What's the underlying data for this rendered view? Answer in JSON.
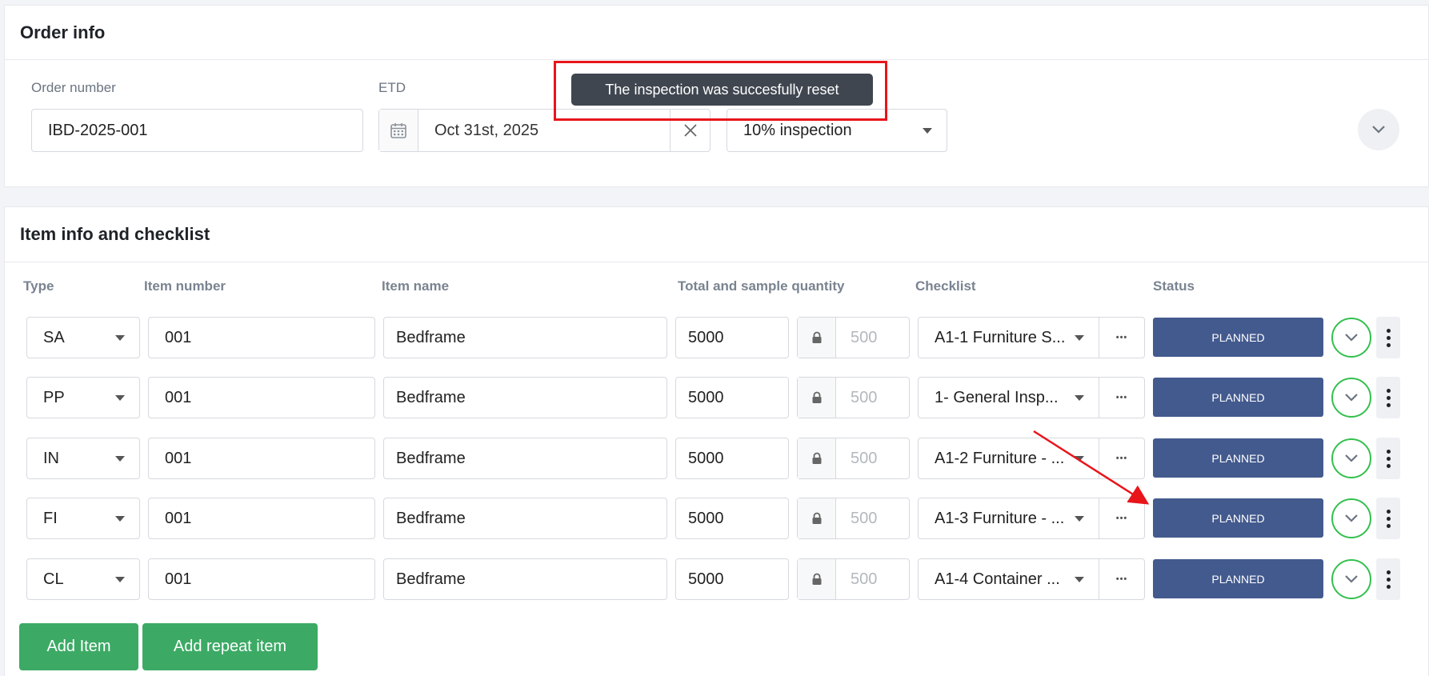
{
  "order_info": {
    "title": "Order info",
    "order_number_label": "Order number",
    "order_number_value": "IBD-2025-001",
    "etd_label": "ETD",
    "etd_value": "Oct 31st, 2025",
    "inspection_type_value": "10% inspection"
  },
  "toast": {
    "message": "The inspection was succesfully reset"
  },
  "items": {
    "title": "Item info and checklist",
    "columns": {
      "type": "Type",
      "item_number": "Item number",
      "item_name": "Item name",
      "quantity": "Total and sample quantity",
      "checklist": "Checklist",
      "status": "Status"
    },
    "rows": [
      {
        "type": "SA",
        "item_number": "001",
        "item_name": "Bedframe",
        "total_qty": "5000",
        "sample_qty": "500",
        "checklist": "A1-1 Furniture S...",
        "status": "PLANNED"
      },
      {
        "type": "PP",
        "item_number": "001",
        "item_name": "Bedframe",
        "total_qty": "5000",
        "sample_qty": "500",
        "checklist": "1- General Insp...",
        "status": "PLANNED"
      },
      {
        "type": "IN",
        "item_number": "001",
        "item_name": "Bedframe",
        "total_qty": "5000",
        "sample_qty": "500",
        "checklist": "A1-2 Furniture - ...",
        "status": "PLANNED"
      },
      {
        "type": "FI",
        "item_number": "001",
        "item_name": "Bedframe",
        "total_qty": "5000",
        "sample_qty": "500",
        "checklist": "A1-3 Furniture - ...",
        "status": "PLANNED"
      },
      {
        "type": "CL",
        "item_number": "001",
        "item_name": "Bedframe",
        "total_qty": "5000",
        "sample_qty": "500",
        "checklist": "A1-4 Container ...",
        "status": "PLANNED"
      }
    ],
    "add_item_label": "Add Item",
    "add_repeat_item_label": "Add repeat item"
  },
  "icons": {
    "calendar": "calendar-icon",
    "clear": "close-icon",
    "chevron": "chevron-down-icon",
    "lock": "lock-icon",
    "more": "more-horizontal-icon",
    "kebab": "more-vertical-icon"
  },
  "colors": {
    "status_planned": "#435a8e",
    "primary_green": "#3caa65",
    "expand_ring": "#33c04e",
    "toast_bg": "#3f4650",
    "annotation_red": "#e8151b"
  }
}
